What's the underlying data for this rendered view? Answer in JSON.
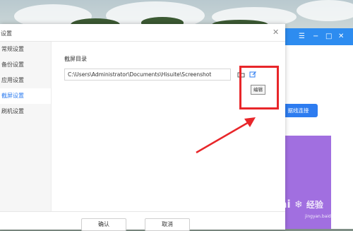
{
  "dialog": {
    "title": "设置",
    "close_icon": "close-icon",
    "sidebar": {
      "items": [
        {
          "label": "常规设置",
          "active": false
        },
        {
          "label": "备份设置",
          "active": false
        },
        {
          "label": "应用设置",
          "active": false
        },
        {
          "label": "截屏设置",
          "active": true
        },
        {
          "label": "刷机设置",
          "active": false
        }
      ]
    },
    "screenshot_section": {
      "label": "截屏目录",
      "path_value": "C:\\Users\\Administrator\\Documents\\Hisuite\\Screenshot",
      "folder_icon": "folder-icon",
      "edit_icon": "edit-icon",
      "tooltip": "编辑"
    },
    "footer": {
      "confirm_label": "确认",
      "cancel_label": "取消"
    }
  },
  "background_app": {
    "button_label": "据线连接",
    "accent": "#2d8cf0",
    "controls": [
      "menu-icon",
      "minimize-icon",
      "maximize-icon",
      "close-icon"
    ]
  },
  "annotation": {
    "color": "#e8262a"
  },
  "watermark": {
    "text": "Bai",
    "text2": "经验",
    "sub": "jingyan.baidu.com"
  },
  "colors": {
    "accent": "#2d7cf0",
    "active_text": "#2d7cf0",
    "purple_panel": "#a16fe0"
  }
}
